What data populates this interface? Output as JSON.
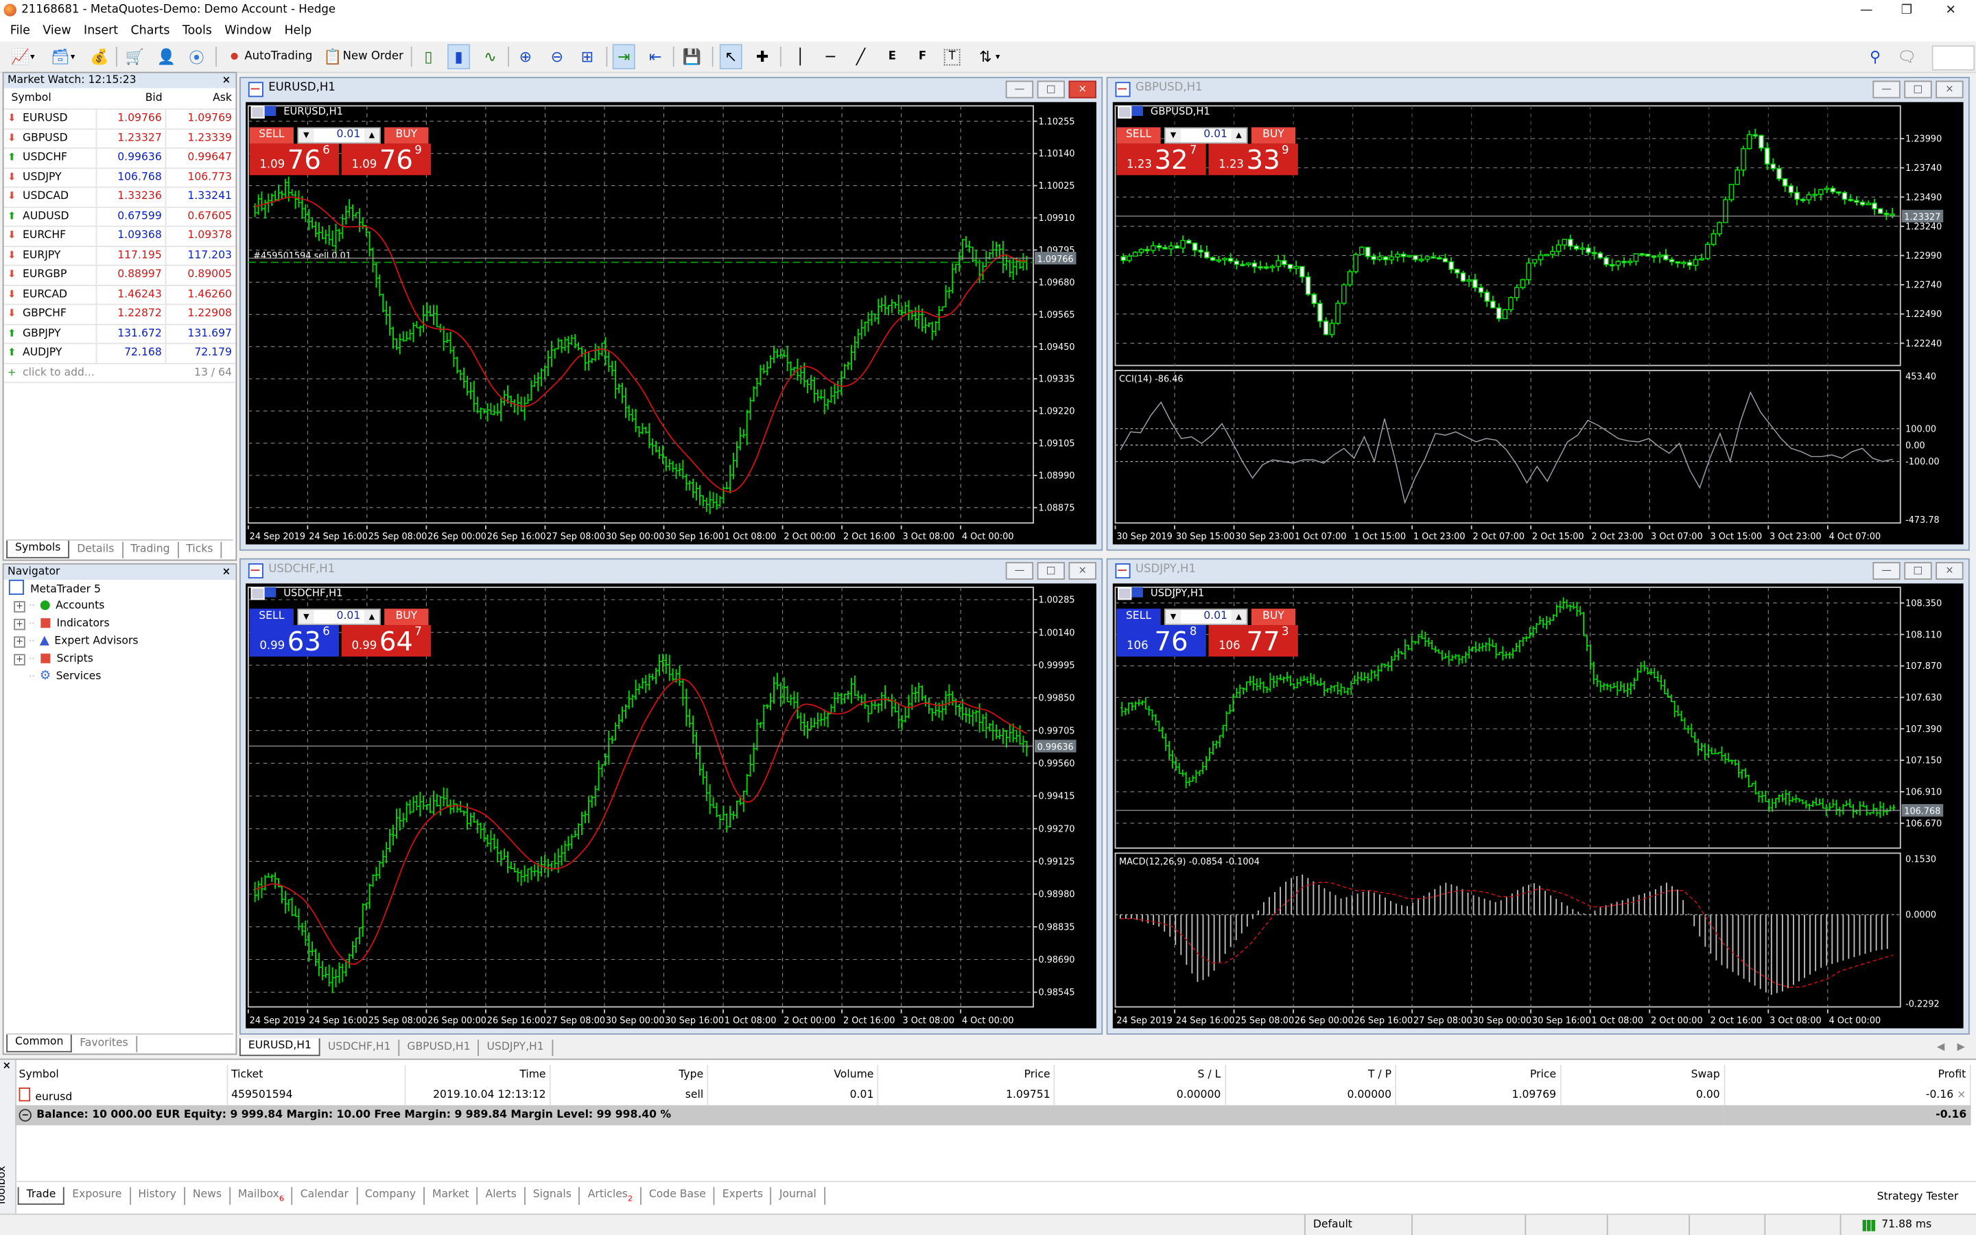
{
  "window": {
    "title": "21168681 - MetaQuotes-Demo: Demo Account - Hedge",
    "controls": [
      "minimize",
      "restore",
      "close"
    ]
  },
  "menu": [
    "File",
    "View",
    "Insert",
    "Charts",
    "Tools",
    "Window",
    "Help"
  ],
  "toolbar": {
    "autotrading_label": "AutoTrading",
    "new_order_label": "New Order",
    "icons": [
      "new-chart-icon",
      "profiles-icon",
      "strategy-icon",
      "market-icon",
      "signals-icon",
      "vps-icon",
      "bar-chart-icon",
      "candlestick-icon",
      "line-chart-icon",
      "zoom-in-icon",
      "zoom-out-icon",
      "tile-windows-icon",
      "autoscroll-icon",
      "chart-shift-icon",
      "templates-icon",
      "cursor-icon",
      "crosshair-icon",
      "vertical-line-icon",
      "horizontal-line-icon",
      "trendline-icon",
      "elliott-icon",
      "fibonacci-icon",
      "text-icon",
      "arrows-icon",
      "search-icon",
      "chat-icon"
    ]
  },
  "market_watch": {
    "title": "Market Watch: 12:15:23",
    "columns": [
      "Symbol",
      "Bid",
      "Ask"
    ],
    "rows": [
      {
        "symbol": "EURUSD",
        "dir": "down",
        "bid": "1.09766",
        "bid_dir": "down",
        "ask": "1.09769",
        "ask_dir": "down"
      },
      {
        "symbol": "GBPUSD",
        "dir": "down",
        "bid": "1.23327",
        "bid_dir": "down",
        "ask": "1.23339",
        "ask_dir": "down"
      },
      {
        "symbol": "USDCHF",
        "dir": "up",
        "bid": "0.99636",
        "bid_dir": "up",
        "ask": "0.99647",
        "ask_dir": "down"
      },
      {
        "symbol": "USDJPY",
        "dir": "down",
        "bid": "106.768",
        "bid_dir": "up",
        "ask": "106.773",
        "ask_dir": "down"
      },
      {
        "symbol": "USDCAD",
        "dir": "down",
        "bid": "1.33236",
        "bid_dir": "down",
        "ask": "1.33241",
        "ask_dir": "up"
      },
      {
        "symbol": "AUDUSD",
        "dir": "up",
        "bid": "0.67599",
        "bid_dir": "up",
        "ask": "0.67605",
        "ask_dir": "down"
      },
      {
        "symbol": "EURCHF",
        "dir": "down",
        "bid": "1.09368",
        "bid_dir": "up",
        "ask": "1.09378",
        "ask_dir": "down"
      },
      {
        "symbol": "EURJPY",
        "dir": "down",
        "bid": "117.195",
        "bid_dir": "down",
        "ask": "117.203",
        "ask_dir": "up"
      },
      {
        "symbol": "EURGBP",
        "dir": "down",
        "bid": "0.88997",
        "bid_dir": "down",
        "ask": "0.89005",
        "ask_dir": "down"
      },
      {
        "symbol": "EURCAD",
        "dir": "down",
        "bid": "1.46243",
        "bid_dir": "down",
        "ask": "1.46260",
        "ask_dir": "down"
      },
      {
        "symbol": "GBPCHF",
        "dir": "down",
        "bid": "1.22872",
        "bid_dir": "down",
        "ask": "1.22908",
        "ask_dir": "down"
      },
      {
        "symbol": "GBPJPY",
        "dir": "up",
        "bid": "131.672",
        "bid_dir": "up",
        "ask": "131.697",
        "ask_dir": "up"
      },
      {
        "symbol": "AUDJPY",
        "dir": "up",
        "bid": "72.168",
        "bid_dir": "up",
        "ask": "72.179",
        "ask_dir": "up"
      }
    ],
    "add_label": "click to add...",
    "count": "13 / 64",
    "tabs": [
      "Symbols",
      "Details",
      "Trading",
      "Ticks"
    ],
    "active_tab": "Symbols"
  },
  "navigator": {
    "title": "Navigator",
    "root": "MetaTrader 5",
    "items": [
      {
        "label": "Accounts",
        "icon": "accounts-icon",
        "expandable": true
      },
      {
        "label": "Indicators",
        "icon": "indicators-icon",
        "expandable": true
      },
      {
        "label": "Expert Advisors",
        "icon": "expert-advisors-icon",
        "expandable": true
      },
      {
        "label": "Scripts",
        "icon": "scripts-icon",
        "expandable": true
      },
      {
        "label": "Services",
        "icon": "services-icon",
        "expandable": false
      }
    ],
    "tabs": [
      "Common",
      "Favorites"
    ],
    "active_tab": "Common"
  },
  "charts": [
    {
      "id": "eurusd",
      "window_title": "EURUSD,H1",
      "chart_label": "EURUSD,H1",
      "active": true,
      "sell_color": "#d0211c",
      "buy_color": "#d0211c",
      "volume": "0.01",
      "sell": {
        "pre": "1.09",
        "big": "76",
        "sup": "6"
      },
      "buy": {
        "pre": "1.09",
        "big": "76",
        "sup": "9"
      },
      "price_ticks": [
        "1.10255",
        "1.10140",
        "1.10025",
        "1.09910",
        "1.09795",
        "1.09680",
        "1.09565",
        "1.09450",
        "1.09335",
        "1.09220",
        "1.09105",
        "1.08990",
        "1.08875"
      ],
      "ylim": [
        1.0882,
        1.1031
      ],
      "current_price": "1.09766",
      "current_value": 1.09766,
      "order_line": {
        "label": "#459501594 sell 0.01",
        "price": 1.09751
      },
      "time_ticks": [
        "24 Sep 2019",
        "24 Sep 16:00",
        "25 Sep 08:00",
        "26 Sep 00:00",
        "26 Sep 16:00",
        "27 Sep 08:00",
        "30 Sep 00:00",
        "30 Sep 16:00",
        "1 Oct 08:00",
        "2 Oct 00:00",
        "2 Oct 16:00",
        "3 Oct 08:00",
        "4 Oct 00:00"
      ],
      "style": "bars",
      "ma": true,
      "path": [
        1.0995,
        1.0998,
        1.1002,
        1.0993,
        1.0985,
        1.0983,
        1.0995,
        1.0987,
        1.0962,
        1.0945,
        1.095,
        1.0958,
        1.0948,
        1.0935,
        1.0924,
        1.092,
        1.0928,
        1.0922,
        1.0935,
        1.0944,
        1.0948,
        1.094,
        1.0945,
        1.093,
        1.0918,
        1.0912,
        1.0905,
        1.09,
        1.0893,
        1.0888,
        1.0895,
        1.0915,
        1.0935,
        1.0942,
        1.0938,
        1.0934,
        1.0925,
        1.093,
        1.0945,
        1.0955,
        1.096,
        1.0958,
        1.0956,
        1.095,
        1.0965,
        1.0985,
        1.0972,
        1.098,
        1.0973,
        1.0977
      ]
    },
    {
      "id": "gbpusd",
      "window_title": "GBPUSD,H1",
      "chart_label": "GBPUSD,H1",
      "active": false,
      "sell_color": "#d0211c",
      "buy_color": "#d0211c",
      "volume": "0.01",
      "sell": {
        "pre": "1.23",
        "big": "32",
        "sup": "7"
      },
      "buy": {
        "pre": "1.23",
        "big": "33",
        "sup": "9"
      },
      "price_ticks": [
        "1.23990",
        "1.23740",
        "1.23490",
        "1.23240",
        "1.22990",
        "1.22740",
        "1.22490",
        "1.22240"
      ],
      "ylim": [
        1.2205,
        1.2427
      ],
      "current_price": "1.23327",
      "current_value": 1.23327,
      "time_ticks": [
        "30 Sep 2019",
        "30 Sep 15:00",
        "30 Sep 23:00",
        "1 Oct 07:00",
        "1 Oct 15:00",
        "1 Oct 23:00",
        "2 Oct 07:00",
        "2 Oct 15:00",
        "2 Oct 23:00",
        "3 Oct 07:00",
        "3 Oct 15:00",
        "3 Oct 23:00",
        "4 Oct 07:00"
      ],
      "style": "candles",
      "ma": false,
      "path": [
        1.2298,
        1.2302,
        1.231,
        1.2306,
        1.2312,
        1.23,
        1.2296,
        1.2294,
        1.2292,
        1.229,
        1.2296,
        1.2288,
        1.2262,
        1.2228,
        1.227,
        1.2304,
        1.2298,
        1.2296,
        1.23,
        1.2298,
        1.2294,
        1.2288,
        1.2276,
        1.2262,
        1.2246,
        1.227,
        1.2294,
        1.23,
        1.2312,
        1.2305,
        1.2298,
        1.2292,
        1.2296,
        1.23,
        1.2298,
        1.2295,
        1.229,
        1.23,
        1.233,
        1.237,
        1.2405,
        1.238,
        1.236,
        1.2345,
        1.235,
        1.2355,
        1.235,
        1.2345,
        1.234,
        1.2333
      ],
      "indicator": {
        "label": "CCI(14) -86.46",
        "type": "line",
        "ticks": [
          "453.40",
          "100.00",
          "0.00",
          "-100.00",
          "-473.78"
        ],
        "levels": [
          100,
          0,
          -100
        ],
        "ylim": [
          -473.78,
          453.4
        ],
        "values": [
          -30,
          80,
          75,
          180,
          260,
          140,
          40,
          50,
          10,
          60,
          130,
          20,
          -100,
          -200,
          -120,
          -90,
          -100,
          -110,
          -90,
          -90,
          -110,
          -60,
          -20,
          -80,
          50,
          -100,
          160,
          -80,
          -350,
          -200,
          -80,
          70,
          60,
          80,
          50,
          20,
          40,
          30,
          -30,
          -120,
          -230,
          -130,
          -220,
          -100,
          20,
          60,
          150,
          120,
          80,
          40,
          25,
          20,
          40,
          -10,
          -50,
          10,
          -150,
          -260,
          -80,
          70,
          -100,
          140,
          320,
          200,
          120,
          40,
          -20,
          -40,
          -70,
          -70,
          -60,
          -80,
          -40,
          -20,
          -80,
          -100,
          -86
        ]
      }
    },
    {
      "id": "usdchf",
      "window_title": "USDCHF,H1",
      "chart_label": "USDCHF,H1",
      "active": false,
      "sell_color": "#1f35d6",
      "buy_color": "#d0211c",
      "volume": "0.01",
      "sell": {
        "pre": "0.99",
        "big": "63",
        "sup": "6"
      },
      "buy": {
        "pre": "0.99",
        "big": "64",
        "sup": "7"
      },
      "price_ticks": [
        "1.00285",
        "1.00140",
        "0.99995",
        "0.99850",
        "0.99705",
        "0.99560",
        "0.99415",
        "0.99270",
        "0.99125",
        "0.98980",
        "0.98835",
        "0.98690",
        "0.98545"
      ],
      "ylim": [
        0.9848,
        1.0034
      ],
      "current_price": "0.99636",
      "current_value": 0.99636,
      "time_ticks": [
        "24 Sep 2019",
        "24 Sep 16:00",
        "25 Sep 08:00",
        "26 Sep 00:00",
        "26 Sep 16:00",
        "27 Sep 08:00",
        "30 Sep 00:00",
        "30 Sep 16:00",
        "1 Oct 08:00",
        "2 Oct 00:00",
        "2 Oct 16:00",
        "3 Oct 08:00",
        "4 Oct 00:00"
      ],
      "style": "bars",
      "ma": true,
      "path": [
        0.99,
        0.9905,
        0.9895,
        0.988,
        0.9865,
        0.986,
        0.987,
        0.9895,
        0.9915,
        0.993,
        0.9938,
        0.9935,
        0.994,
        0.9935,
        0.9928,
        0.992,
        0.9912,
        0.9905,
        0.991,
        0.9912,
        0.992,
        0.9935,
        0.9955,
        0.9975,
        0.9985,
        0.9992,
        1.0002,
        0.999,
        0.996,
        0.9935,
        0.993,
        0.9942,
        0.9975,
        0.999,
        0.9985,
        0.9972,
        0.9975,
        0.9985,
        0.999,
        0.9978,
        0.9985,
        0.9975,
        0.999,
        0.9978,
        0.9985,
        0.998,
        0.9975,
        0.997,
        0.9968,
        0.9964
      ]
    },
    {
      "id": "usdjpy",
      "window_title": "USDJPY,H1",
      "chart_label": "USDJPY,H1",
      "active": false,
      "sell_color": "#1f35d6",
      "buy_color": "#d0211c",
      "volume": "0.01",
      "sell": {
        "pre": "106",
        "big": "76",
        "sup": "8"
      },
      "buy": {
        "pre": "106",
        "big": "77",
        "sup": "3"
      },
      "price_ticks": [
        "108.350",
        "108.110",
        "107.870",
        "107.630",
        "107.390",
        "107.150",
        "106.910",
        "106.670"
      ],
      "ylim": [
        106.48,
        108.47
      ],
      "current_price": "106.768",
      "current_value": 106.768,
      "time_ticks": [
        "24 Sep 2019",
        "24 Sep 16:00",
        "25 Sep 08:00",
        "26 Sep 00:00",
        "26 Sep 16:00",
        "27 Sep 08:00",
        "30 Sep 00:00",
        "30 Sep 16:00",
        "1 Oct 08:00",
        "2 Oct 00:00",
        "2 Oct 16:00",
        "3 Oct 08:00",
        "4 Oct 00:00"
      ],
      "style": "bars",
      "ma": false,
      "path": [
        107.55,
        107.6,
        107.5,
        107.2,
        107.0,
        107.05,
        107.3,
        107.6,
        107.75,
        107.7,
        107.8,
        107.72,
        107.76,
        107.7,
        107.68,
        107.75,
        107.82,
        107.9,
        108.0,
        108.1,
        107.95,
        107.92,
        107.98,
        108.05,
        107.96,
        108.0,
        108.15,
        108.22,
        108.35,
        108.3,
        107.75,
        107.68,
        107.7,
        107.85,
        107.75,
        107.55,
        107.35,
        107.2,
        107.18,
        107.1,
        106.95,
        106.8,
        106.88,
        106.84,
        106.8,
        106.8,
        106.79,
        106.78,
        106.77,
        106.768
      ],
      "indicator": {
        "label": "MACD(12,26,9) -0.0854 -0.1004",
        "type": "macd",
        "ticks": [
          "0.1530",
          "0.0000",
          "-0.2292"
        ],
        "levels": [
          0
        ],
        "ylim": [
          -0.2292,
          0.153
        ],
        "values": [
          -0.01,
          -0.01,
          -0.02,
          -0.03,
          -0.06,
          -0.12,
          -0.17,
          -0.15,
          -0.1,
          -0.06,
          -0.02,
          0.03,
          0.06,
          0.09,
          0.1,
          0.08,
          0.06,
          0.04,
          0.05,
          0.06,
          0.05,
          0.03,
          0.02,
          0.04,
          0.06,
          0.08,
          0.07,
          0.05,
          0.04,
          0.03,
          0.05,
          0.07,
          0.08,
          0.05,
          0.03,
          0.01,
          0.0,
          0.02,
          0.03,
          0.04,
          0.05,
          0.06,
          0.08,
          0.06,
          -0.02,
          -0.08,
          -0.12,
          -0.14,
          -0.16,
          -0.18,
          -0.2,
          -0.19,
          -0.17,
          -0.15,
          -0.13,
          -0.12,
          -0.11,
          -0.1,
          -0.09,
          -0.085
        ],
        "signal": [
          -0.01,
          -0.01,
          -0.015,
          -0.02,
          -0.03,
          -0.06,
          -0.1,
          -0.12,
          -0.12,
          -0.1,
          -0.07,
          -0.03,
          0.01,
          0.04,
          0.07,
          0.08,
          0.08,
          0.07,
          0.06,
          0.06,
          0.055,
          0.05,
          0.04,
          0.04,
          0.045,
          0.055,
          0.06,
          0.06,
          0.055,
          0.045,
          0.045,
          0.055,
          0.065,
          0.06,
          0.05,
          0.035,
          0.02,
          0.02,
          0.025,
          0.03,
          0.04,
          0.05,
          0.06,
          0.06,
          0.03,
          -0.02,
          -0.07,
          -0.1,
          -0.13,
          -0.15,
          -0.17,
          -0.18,
          -0.18,
          -0.17,
          -0.16,
          -0.14,
          -0.13,
          -0.12,
          -0.11,
          -0.1004
        ]
      }
    }
  ],
  "chart_tabs": [
    "EURUSD,H1",
    "USDCHF,H1",
    "GBPUSD,H1",
    "USDJPY,H1"
  ],
  "active_chart_tab": "EURUSD,H1",
  "toolbox": {
    "side_label": "Toolbox",
    "columns": [
      "Symbol",
      "Ticket",
      "Time",
      "Type",
      "Volume",
      "Price",
      "S / L",
      "T / P",
      "Price",
      "Swap",
      "Profit"
    ],
    "positions": [
      {
        "symbol": "eurusd",
        "ticket": "459501594",
        "time": "2019.10.04 12:13:12",
        "type": "sell",
        "volume": "0.01",
        "price": "1.09751",
        "sl": "0.00000",
        "tp": "0.00000",
        "current_price": "1.09769",
        "swap": "0.00",
        "profit": "-0.16"
      }
    ],
    "balance_line": "Balance: 10 000.00 EUR  Equity: 9 999.84  Margin: 10.00  Free Margin: 9 989.84  Margin Level: 99 998.40 %",
    "total_profit": "-0.16",
    "tabs": [
      {
        "label": "Trade"
      },
      {
        "label": "Exposure"
      },
      {
        "label": "History"
      },
      {
        "label": "News"
      },
      {
        "label": "Mailbox",
        "badge": "6"
      },
      {
        "label": "Calendar"
      },
      {
        "label": "Company"
      },
      {
        "label": "Market"
      },
      {
        "label": "Alerts"
      },
      {
        "label": "Signals"
      },
      {
        "label": "Articles",
        "badge": "2"
      },
      {
        "label": "Code Base"
      },
      {
        "label": "Experts"
      },
      {
        "label": "Journal"
      }
    ],
    "active_tab": "Trade",
    "strategy_tester_label": "Strategy Tester"
  },
  "status_bar": {
    "profile": "Default",
    "ping": "71.88 ms"
  },
  "colors": {
    "bull": "#00e000",
    "bear": "#00e000",
    "ma": "#d01010",
    "grid": "#7a7a7a",
    "price_line": "#888888",
    "order_line": "#00a000",
    "sell_red": "#d0211c",
    "sell_blue": "#1f35d6"
  }
}
